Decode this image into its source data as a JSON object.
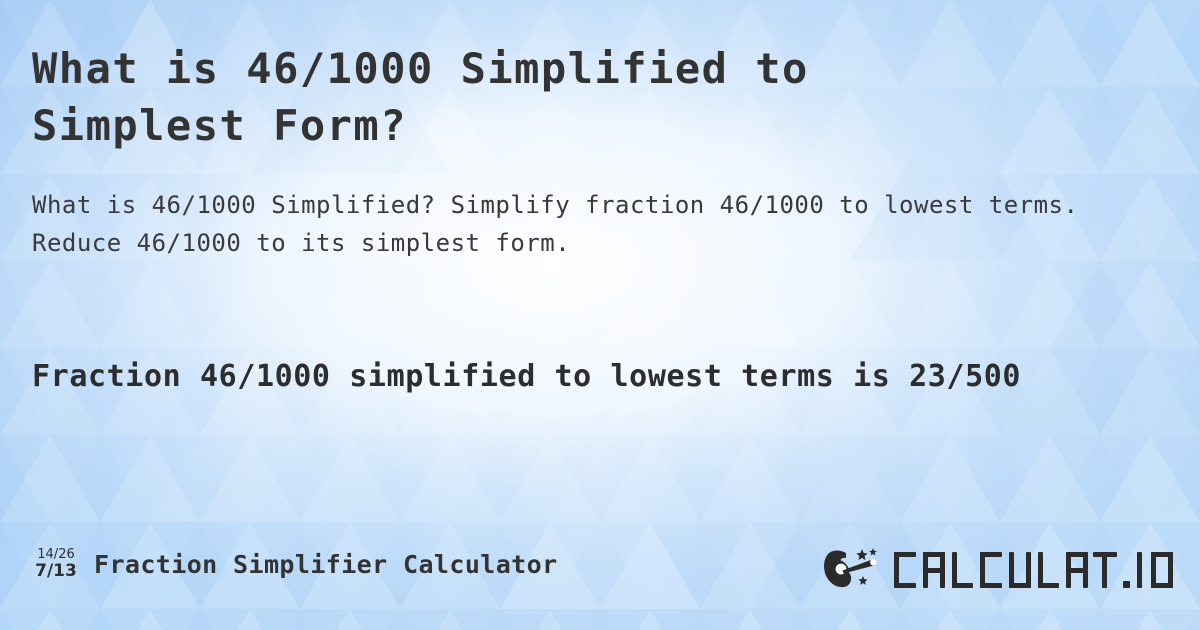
{
  "page": {
    "title": "What is 46/1000 Simplified to\nSimplest Form?",
    "subtitle": "What is 46/1000 Simplified? Simplify fraction 46/1000 to lowest terms. Reduce 46/1000 to its simplest form.",
    "result_statement": "Fraction 46/1000 simplified to lowest terms is 23/500"
  },
  "fraction": {
    "original": "46/1000",
    "simplified": "23/500",
    "numerator": 46,
    "denominator": 1000,
    "simplified_numerator": 23,
    "simplified_denominator": 500
  },
  "footer": {
    "icon": {
      "name": "fraction-reduction-icon",
      "top_fraction": "14/26",
      "bottom_fraction": "7/13"
    },
    "title": "Fraction Simplifier Calculator",
    "logo": {
      "name": "calculatio-logo",
      "wordmark": "CALCULAT.IO",
      "wand_icon": "hand-holding-magic-wand-icon"
    }
  },
  "colors": {
    "background_base": "#bcdcfa",
    "background_light": "#ffffff",
    "background_blue": "#a6cdf4",
    "text_dark": "#333333",
    "text_body": "#3a3a3a",
    "logo_dark": "#2b2b2b"
  }
}
